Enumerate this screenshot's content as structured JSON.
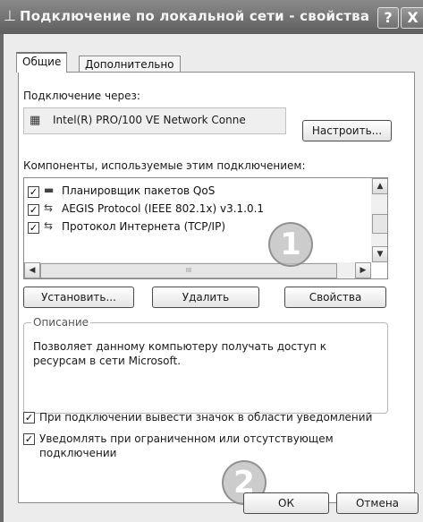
{
  "window": {
    "title": "Подключение по локальной сети - свойства",
    "help_label": "?",
    "close_label": "X"
  },
  "tabs": [
    {
      "label": "Общие",
      "active": true
    },
    {
      "label": "Дополнительно",
      "active": false
    }
  ],
  "connect_using": {
    "label": "Подключение через:",
    "adapter_name": "Intel(R) PRO/100 VE Network Conne",
    "configure_label": "Настроить..."
  },
  "components": {
    "label": "Компоненты, используемые этим подключением:",
    "items": [
      {
        "label": "Планировщик пакетов QoS",
        "checked": true,
        "icon": "scheduler-icon"
      },
      {
        "label": "AEGIS Protocol (IEEE 802.1x) v3.1.0.1",
        "checked": true,
        "icon": "protocol-icon"
      },
      {
        "label": "Протокол Интернета (TCP/IP)",
        "checked": true,
        "icon": "protocol-icon"
      }
    ],
    "hscroll_grip": "III"
  },
  "buttons": {
    "install": "Установить...",
    "uninstall": "Удалить",
    "properties": "Свойства",
    "ok": "ОК",
    "cancel": "Отмена"
  },
  "description": {
    "legend": "Описание",
    "text": "Позволяет данному компьютеру получать доступ к ресурсам в сети Microsoft."
  },
  "options": [
    {
      "label": "При подключении вывести значок в области уведомлений",
      "checked": true
    },
    {
      "label": "Уведомлять при ограниченном или отсутствующем подключении",
      "checked": true
    }
  ],
  "markers": [
    "1",
    "2"
  ]
}
